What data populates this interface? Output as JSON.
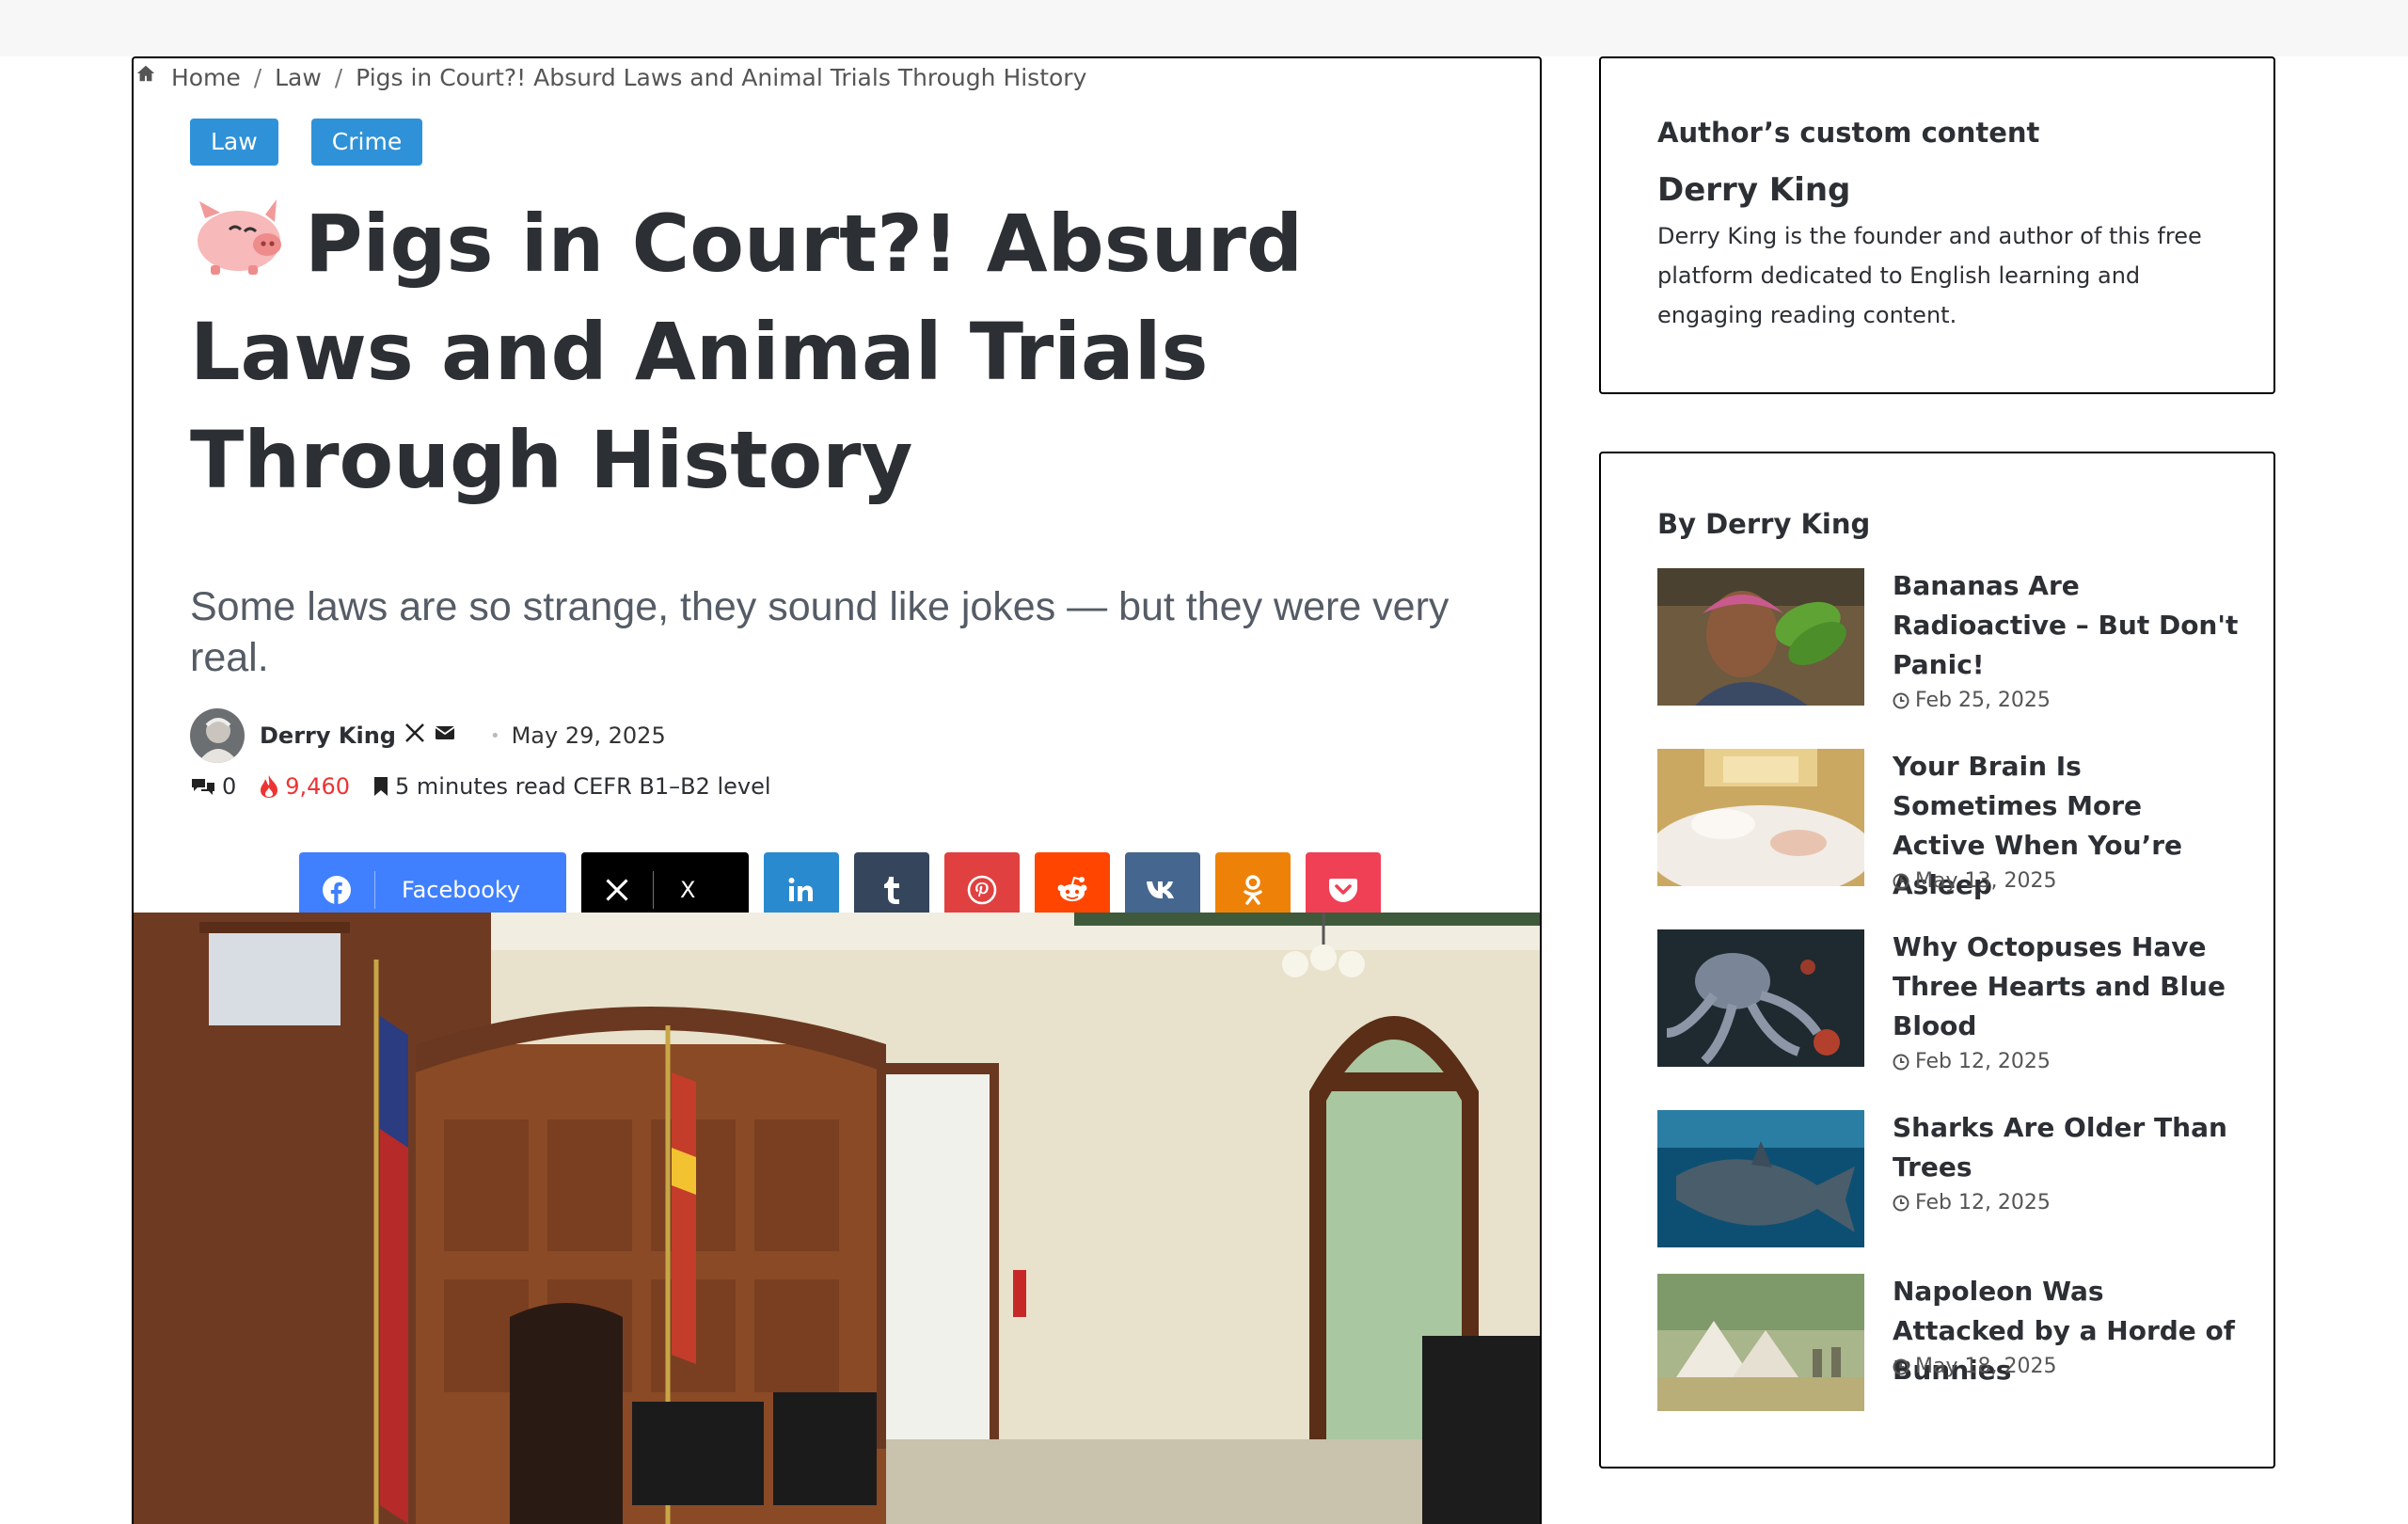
{
  "breadcrumb": {
    "home": "Home",
    "category": "Law",
    "current": "Pigs in Court?! Absurd Laws and Animal Trials Through History"
  },
  "categories": [
    "Law",
    "Crime"
  ],
  "article": {
    "title": "Pigs in Court?! Absurd Laws and Animal Trials Through History",
    "subtitle": "Some laws are so strange, they sound like jokes — but they were very real.",
    "author": "Derry King",
    "date": "May 29, 2025",
    "comments": "0",
    "views": "9,460",
    "read_time": "5 minutes read CEFR B1–B2 level"
  },
  "share": {
    "facebook_label": "Facebooky",
    "x_label": "X"
  },
  "icons": {
    "title": "pig-face-icon",
    "home": "home-icon",
    "comments": "comments-icon",
    "views": "fire-icon",
    "read": "bookmark-icon",
    "date": "clock-icon"
  },
  "colors": {
    "category_bg": "#2f92d8",
    "facebook": "#4080ff",
    "x": "#000000",
    "linkedin": "#2a8ad0",
    "tumblr": "#35465c",
    "pinterest": "#e0403f",
    "reddit": "#ff4500",
    "vk": "#45668e",
    "odnoklassniki": "#ee8208",
    "pocket": "#ef4056",
    "views": "#ee3333"
  },
  "sidebar": {
    "author_widget": {
      "title": "Author’s custom content",
      "name": "Derry King",
      "bio": "Derry King is the founder and author of this free platform dedicated to English learning and engaging reading content."
    },
    "posts_widget": {
      "title": "By Derry King",
      "posts": [
        {
          "title": "Bananas Are Radioactive – But Don't Panic!",
          "date": "Feb 25, 2025"
        },
        {
          "title": "Your Brain Is Sometimes More Active When You’re Asleep",
          "date": "May 13, 2025"
        },
        {
          "title": "Why Octopuses Have Three Hearts and Blue Blood",
          "date": "Feb 12, 2025"
        },
        {
          "title": "Sharks Are Older Than Trees",
          "date": "Feb 12, 2025"
        },
        {
          "title": "Napoleon Was Attacked by a Horde of Bunnies",
          "date": "May 18, 2025"
        }
      ]
    }
  }
}
